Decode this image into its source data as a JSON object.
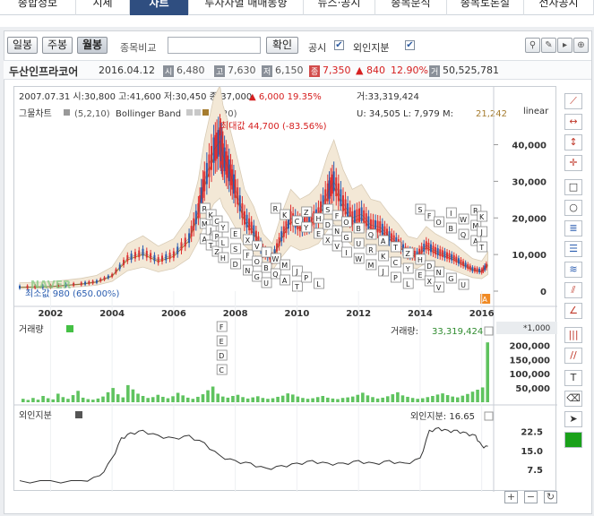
{
  "topnav": {
    "tabs": [
      "종합정보",
      "시세",
      "차트",
      "투자자별 매매동향",
      "뉴스·공시",
      "종목분석",
      "종목토론실",
      "전자공시"
    ],
    "active_index": 2
  },
  "toolbar": {
    "period_buttons": [
      "일봉",
      "주봉",
      "월봉"
    ],
    "selected_period": "월봉",
    "compare_label": "종목비교",
    "compare_value": "",
    "confirm_label": "확인",
    "disclosure_label": "공시",
    "disclosure_checked": true,
    "foreign_label": "외인지분",
    "foreign_checked": true,
    "icon_names": [
      "bulb-icon",
      "pen-icon",
      "play-icon",
      "zoom-icon"
    ]
  },
  "stock": {
    "name": "두산인프라코어",
    "date": "2016.04.12",
    "open_icon": "시",
    "open": "6,480",
    "high_icon": "고",
    "high": "7,630",
    "low_icon": "저",
    "low": "6,150",
    "close_icon": "종",
    "close": "7,350",
    "change": "▲ 840",
    "change_pct": "12.90%",
    "volume_icon": "거",
    "volume": "50,525,781",
    "up_color": "#e03030"
  },
  "chart_header": {
    "period_line": "2007.07.31 시:30,800 고:41,600 저:30,450 종:37,000",
    "change_line": "▲    6,000  19.35%",
    "volume_line": "거:33,319,424",
    "indicator_group": "그물차트",
    "indicator_group_params": "(5,2,10)",
    "bollinger_label": "Bollinger Band",
    "bollinger_params": "(20)",
    "stats": "U:  34,505  L:     7,979  M:",
    "stats_m": "21,242",
    "scale": "linear",
    "max_label": "최대값 44,700 (-83.56%)",
    "min_label": "최소값 980 (650.00%)",
    "watermark": "NAVER"
  },
  "volume_panel": {
    "title": "거래량",
    "value_label": "거래량:",
    "value": "33,319,424",
    "multiplier": "*1,000"
  },
  "foreign_panel": {
    "title": "외인지분",
    "value_label": "외인지분: 16.65"
  },
  "chart_data": [
    {
      "type": "line",
      "title": "",
      "x_label_ticks": [
        "2002",
        "2004",
        "2006",
        "2008",
        "2010",
        "2012",
        "2014",
        "2016"
      ],
      "y_ticks": [
        "40,000",
        "30,000",
        "20,000",
        "10,000",
        "0"
      ],
      "ylim": [
        0,
        46000
      ],
      "x": [
        2001.0,
        2002.0,
        2003.0,
        2003.5,
        2004.0,
        2004.5,
        2005.0,
        2005.5,
        2006.0,
        2006.5,
        2006.8,
        2007.0,
        2007.3,
        2007.5,
        2007.6,
        2007.8,
        2008.0,
        2008.3,
        2008.6,
        2008.9,
        2009.2,
        2009.5,
        2009.8,
        2010.1,
        2010.4,
        2010.7,
        2011.0,
        2011.2,
        2011.5,
        2011.8,
        2012.1,
        2012.4,
        2012.7,
        2013.0,
        2013.3,
        2013.6,
        2013.9,
        2014.2,
        2014.5,
        2014.8,
        2015.1,
        2015.4,
        2015.7,
        2016.0,
        2016.2
      ],
      "series": [
        {
          "name": "",
          "values": [
            1100,
            1300,
            2000,
            2600,
            4300,
            9000,
            10600,
            8500,
            10000,
            14500,
            22000,
            30000,
            38500,
            41000,
            37000,
            33000,
            28000,
            20000,
            16500,
            11000,
            9000,
            15000,
            20000,
            18000,
            19000,
            21000,
            27000,
            30000,
            24000,
            20000,
            21000,
            18000,
            17500,
            15000,
            13000,
            10500,
            10000,
            12500,
            11000,
            10000,
            9000,
            7500,
            6000,
            5500,
            7350
          ]
        }
      ]
    },
    {
      "type": "bar",
      "title": "",
      "y_ticks": [
        "200,000",
        "150,000",
        "100,000",
        "50,000"
      ],
      "ylim": [
        0,
        220000
      ],
      "values": [
        12000,
        8000,
        15000,
        9000,
        22000,
        14000,
        10000,
        30000,
        18000,
        12000,
        25000,
        40000,
        16000,
        11000,
        9000,
        13000,
        20000,
        35000,
        50000,
        28000,
        17000,
        60000,
        45000,
        30000,
        22000,
        15000,
        18000,
        26000,
        19000,
        14000,
        21000,
        33000,
        24000,
        16000,
        12000,
        19000,
        28000,
        42000,
        55000,
        30000,
        20000,
        16000,
        22000,
        26000,
        18000,
        13000,
        17000,
        21000,
        15000,
        12000,
        14000,
        19000,
        23000,
        31000,
        27000,
        20000,
        15000,
        12000,
        14000,
        18000,
        22000,
        16000,
        13000,
        11000,
        15000,
        17000,
        20000,
        26000,
        33319,
        24000,
        18000,
        13000,
        16000,
        21000,
        28000,
        35000,
        24000,
        19000,
        15000,
        12000,
        14000,
        18000,
        22000,
        27000,
        31000,
        25000,
        20000,
        17000,
        23000,
        29000,
        37000,
        44000,
        52000,
        210000
      ]
    },
    {
      "type": "line",
      "title": "",
      "y_ticks": [
        "22.5",
        "15.0",
        "7.5"
      ],
      "ylim": [
        0,
        27
      ],
      "x": [
        2001.0,
        2002.0,
        2003.0,
        2003.6,
        2004.0,
        2004.3,
        2004.6,
        2005.0,
        2005.5,
        2006.0,
        2006.5,
        2007.0,
        2007.5,
        2008.0,
        2008.5,
        2009.0,
        2009.5,
        2010.0,
        2010.5,
        2011.0,
        2011.5,
        2012.0,
        2012.5,
        2013.0,
        2013.5,
        2014.0,
        2014.3,
        2014.6,
        2014.9,
        2015.2,
        2015.5,
        2015.8,
        2016.0,
        2016.2
      ],
      "series": [
        {
          "name": "외인지분",
          "values": [
            3,
            3,
            3,
            5,
            12,
            20,
            22,
            23,
            21,
            20,
            21,
            18,
            13,
            11,
            10,
            8,
            9,
            10,
            11,
            10,
            10,
            11,
            10,
            11,
            10,
            12,
            23,
            24,
            23,
            23,
            22,
            21,
            17,
            16.65
          ]
        }
      ]
    }
  ]
}
